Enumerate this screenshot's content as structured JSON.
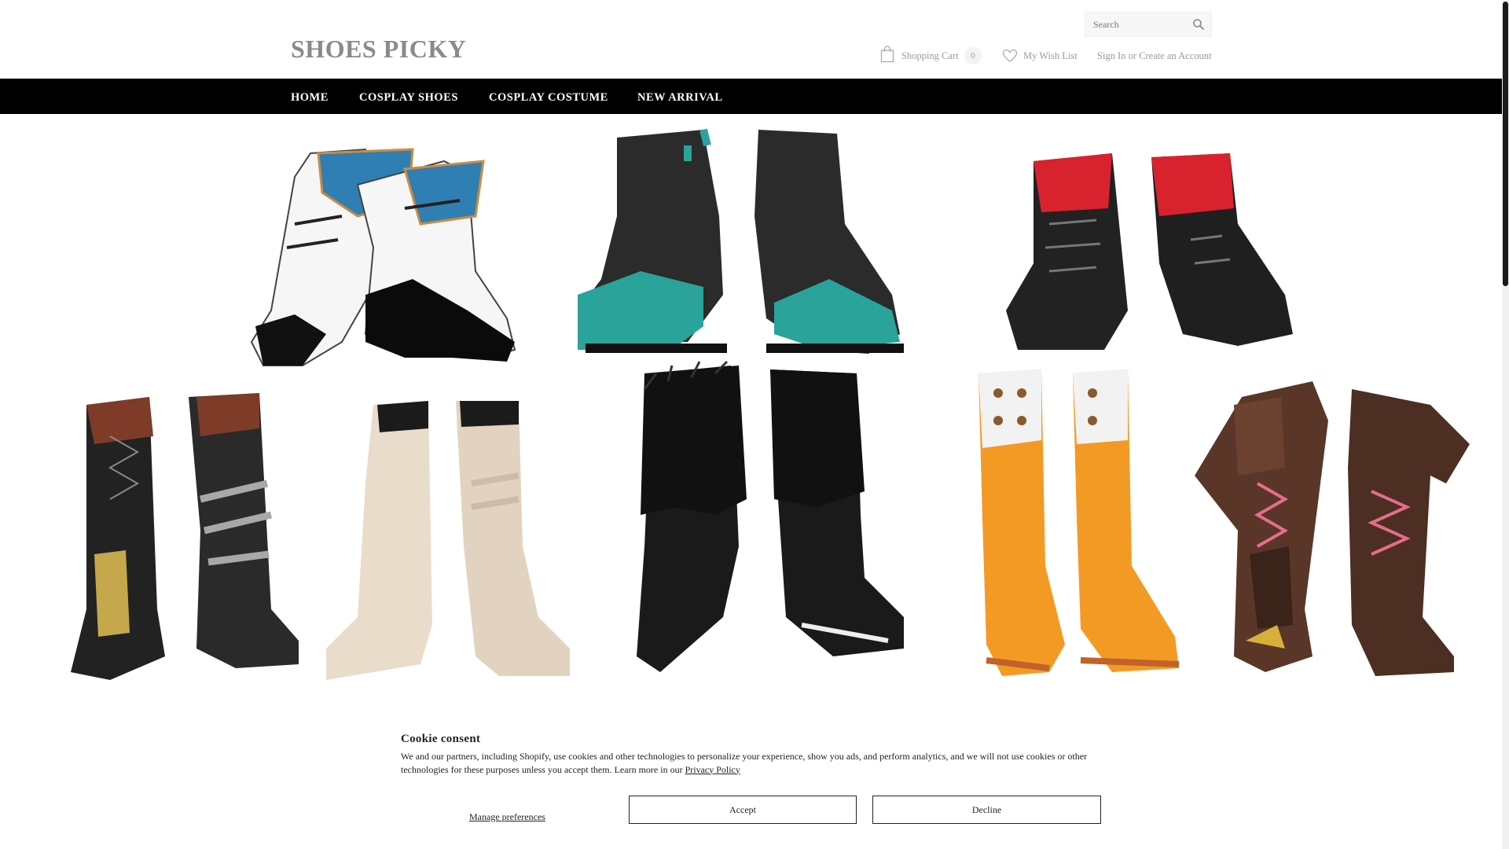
{
  "header": {
    "logo": "SHOES PICKY",
    "search": {
      "placeholder": "Search"
    },
    "cart": {
      "label": "Shopping Cart",
      "count": "0"
    },
    "wishlist": {
      "label": "My Wish List"
    },
    "account": {
      "sign_in": "Sign In",
      "or": "or",
      "create": "Create an Account"
    }
  },
  "nav": {
    "items": [
      {
        "label": "HOME"
      },
      {
        "label": "COSPLAY SHOES"
      },
      {
        "label": "COSPLAY COSTUME"
      },
      {
        "label": "NEW ARRIVAL"
      }
    ]
  },
  "banner": {
    "icons": [
      "shoe-image-white-blue-boot",
      "shoe-image-teal-black-boot",
      "shoe-image-red-black-boot",
      "shoe-image-tall-laced-boot",
      "shoe-image-cream-boot",
      "shoe-image-fur-boot",
      "shoe-image-orange-boot",
      "shoe-image-brown-pink-laced-boot"
    ],
    "colors": {
      "teal": "#2aa39a",
      "red": "#d8232f",
      "orange": "#f39a24",
      "cream": "#e9dccb",
      "brown": "#5a3628",
      "pink": "#e56d8c"
    }
  },
  "cookie": {
    "title": "Cookie consent",
    "text": "We and our partners, including Shopify, use cookies and other technologies to personalize your experience, show you ads, and perform analytics, and we will not use cookies or other technologies for these purposes unless you accept them. Learn more in our",
    "link": "Privacy Policy",
    "manage": "Manage preferences",
    "accept": "Accept",
    "decline": "Decline"
  }
}
